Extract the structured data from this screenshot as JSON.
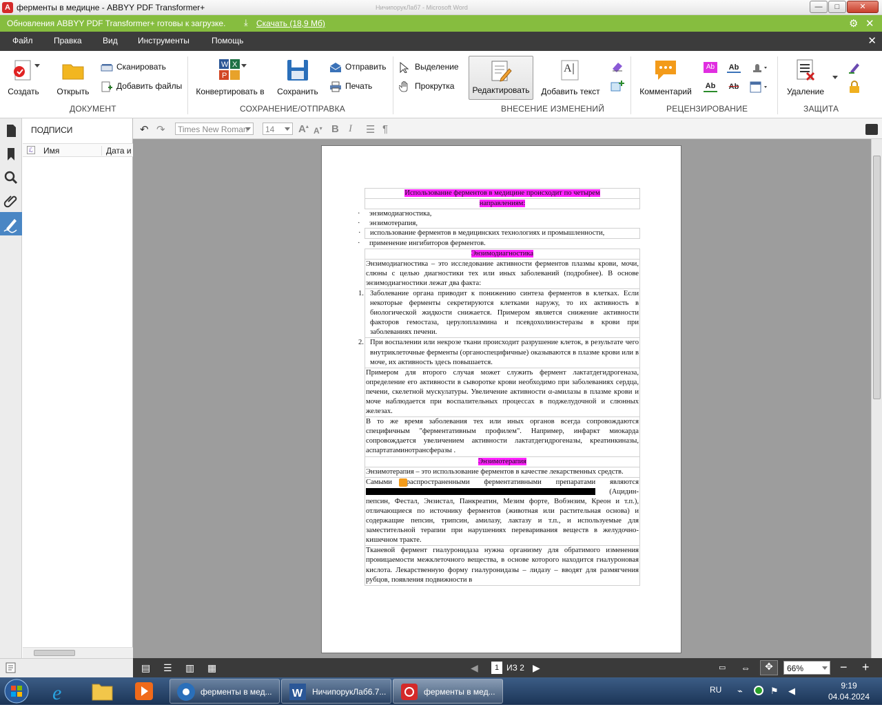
{
  "window": {
    "title": "ферменты в медицне - ABBYY PDF Transformer+",
    "app_icon": "abbyy-logo",
    "background_title": "НичипорукЛаб7 - Microsoft Word",
    "buttons": {
      "minimize": "—",
      "maximize": "□",
      "close": "✕"
    }
  },
  "update_bar": {
    "message": "Обновления ABBYY PDF Transformer+ готовы к загрузке.",
    "download_label": "Скачать (18,9 Мб)",
    "accent_color": "#86bd3f"
  },
  "menu": {
    "items": [
      "Файл",
      "Правка",
      "Вид",
      "Инструменты",
      "Помощь"
    ],
    "close": "✕"
  },
  "ribbon": {
    "groups": {
      "document": "ДОКУМЕНТ",
      "save_send": "СОХРАНЕНИЕ/ОТПРАВКА",
      "editing": "ВНЕСЕНИЕ ИЗМЕНЕНИЙ",
      "review": "РЕЦЕНЗИРОВАНИЕ",
      "protection": "ЗАЩИТА"
    },
    "buttons": {
      "create": "Создать",
      "open": "Открыть",
      "scan": "Сканировать",
      "add_files": "Добавить файлы",
      "convert": "Конвертировать в",
      "save": "Сохранить",
      "send": "Отправить",
      "print": "Печать",
      "select": "Выделение",
      "scroll": "Прокрутка",
      "edit": "Редактировать",
      "add_text": "Добавить текст",
      "comment": "Комментарий",
      "delete": "Удаление"
    },
    "selected": "edit"
  },
  "signature_panel": {
    "header": "ПОДПИСИ",
    "columns": [
      "Имя",
      "Дата и"
    ]
  },
  "format_bar": {
    "font": "Times New Roman",
    "size": "14"
  },
  "document": {
    "title_hl_1": "Использование ферментов в медицине происходит по четырем",
    "title_hl_2": "направлениям:",
    "bullets": [
      "энзимодиагностика,",
      "энзимотерапия,",
      "использование ферментов в медицинских технологиях и промышленности,",
      "применение ингибиторов ферментов."
    ],
    "bullet_mark": "·",
    "h_diag": "Энзимодиагностика",
    "p_diag": "Энзимодиагностика – это исследование активности ферментов плазмы крови, мочи, слюны с целью диагностики тех или иных заболеваний (подробнее). В основе энзимодиагностики лежат два факта:",
    "num1_mark": "1.",
    "num1": "Заболевание органа приводит к понижению синтеза ферментов в клетках. Если некоторые ферменты секретируются клетками наружу, то их активность в биологической жидкости снижается. Примером является снижение активности факторов гемостаза, церулоплазмина и псевдохолинэстеразы в крови при заболеваниях печени.",
    "num2_mark": "2.",
    "num2": "При воспалении или некрозе ткани происходит разрушение клеток, в результате чего внутриклеточные ферменты (органоспецифичные) оказываются в плазме крови или в моче, их активность здесь повышается.",
    "p_example": "Примером для второго случая может служить фермент лактатдегидрогеназа, определение его активности в сыворотке крови необходимо при заболеваниях сердца, печени, скелетной мускулатуры. Увеличение активности α-амилазы в плазме крови и моче наблюдается при воспалительных процессах в поджелудочной и слюнных железах.",
    "p_profile": "В то же время заболевания тех или иных органов всегда сопровождаются специфичным \"ферментативным профилем\". Например, инфаркт миокарда сопровождается увеличением активности лактатдегидрогеназы, креатинкиназы, аспартатаминотрансферазы .",
    "h_ther": "Энзимотерапия",
    "p_ther": "Энзимотерапия – это использование ферментов в качестве лекарственных средств.",
    "p_preps_1": "Самыми распространенными ферментативными препаратами являются",
    "p_preps_2": "(Ацидин-пепсин, Фестал, Энзистал, Панкреатин, Мезим форте, Вобэнзим, Креон и т.п.), отличающиеся по источнику ферментов (животная или растительная основа)  и содержащие пепсин, трипсин, амилазу, лактазу и т.п., и используемые для заместительной терапии при нарушениях переваривания веществ в желудочно-кишечном тракте.",
    "p_hyal": "Тканевой фермент гиалуронидаза нужна организму для обратимого изменения проницаемости межклеточного вещества, в основе которого находится гиалуроновая кислота. Лекарственную форму гиалуронидазы – лидазу – вводят для размягчения рубцов, появления подвижности в",
    "highlight_color": "#ff22ff"
  },
  "status": {
    "page": "1",
    "of": "ИЗ 2",
    "zoom": "66%"
  },
  "taskbar": {
    "tasks": [
      "ферменты в мед...",
      "НичипорукЛаб6.7...",
      "ферменты в мед..."
    ],
    "lang": "RU",
    "time": "9:19",
    "date": "04.04.2024"
  }
}
